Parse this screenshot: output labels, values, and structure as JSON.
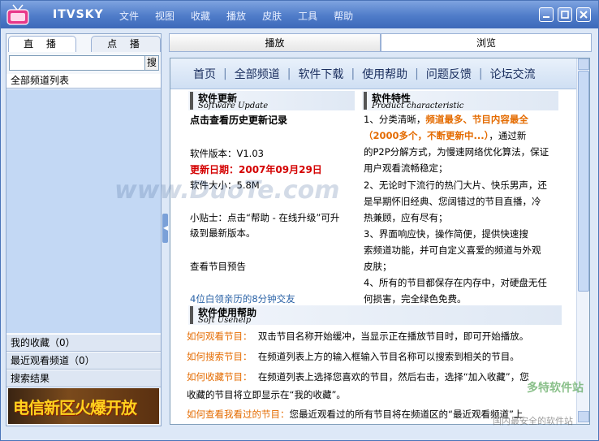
{
  "app": {
    "brand": "ITVSKY"
  },
  "menu": [
    "文件",
    "视图",
    "收藏",
    "播放",
    "皮肤",
    "工具",
    "帮助"
  ],
  "left": {
    "tab_live": "直 播",
    "tab_vod": "点 播",
    "search_value": "",
    "search_button": "搜",
    "channel_header": "全部频道列表",
    "favorites": "我的收藏（0）",
    "recent": "最近观看频道（0）",
    "results": "搜索结果",
    "ad_text": "电信新区火爆开放"
  },
  "right": {
    "tab_play": "播放",
    "tab_browse": "浏览"
  },
  "nav": [
    "首页",
    "全部频道",
    "软件下载",
    "使用帮助",
    "问题反馈",
    "论坛交流"
  ],
  "update": {
    "title": "软件更新",
    "subtitle": "Software Update",
    "history_link": "点击查看历史更新记录",
    "version": "软件版本：V1.03",
    "date": "更新日期：2007年09月29日",
    "size": "软件大小：5.8M",
    "tip_line1": "小贴士：点击“帮助 - 在线升级”可升",
    "tip_line2": "级到最新版本。",
    "preview": "查看节目预告",
    "story": "4位白领亲历的8分钟交友"
  },
  "features": {
    "title": "软件特性",
    "subtitle": "Product characteristic",
    "l1a": "1、分类清晰，",
    "l1b": "频道最多、节目内容最全",
    "l2a": "（2000多个，不断更新中...）",
    "l2b": "，通过新",
    "l3": "的P2P分解方式，为慢速网络优化算法，保证",
    "l4": "用户观看流畅稳定；",
    "l5": "2、无论时下流行的热门大片、快乐男声，还",
    "l6": "是早期怀旧经典、您阔错过的节目直播，冷",
    "l7": "热兼顾，应有尽有；",
    "l8": "3、界面响应快，操作简便，提供快速搜",
    "l9": "索频道功能，并可自定义喜爱的频道与外观",
    "l10": "皮肤；",
    "l11": "4、所有的节目都保存在内存中，对硬盘无任",
    "l12": "何损害，完全绿色免费。"
  },
  "help": {
    "title": "软件使用帮助",
    "subtitle": "Soft Usehelp",
    "q1": "如何观看节目：",
    "a1": "双击节目名称开始缓冲，当显示正在播放节目时，即可开始播放。",
    "q2": "如何搜索节目：",
    "a2": "在频道列表上方的输入框输入节目名称可以搜索到相关的节目。",
    "q3": "如何收藏节目：",
    "a3": "在频道列表上选择您喜欢的节目，然后右击，选择“加入收藏”，您",
    "a3b": "收藏的节目将立即显示在“我的收藏”。",
    "q4": "如何查看我看过的节目：",
    "a4": "您最近观看过的所有节目将在频道区的“最近观看频道”上"
  },
  "watermarks": {
    "w1": "www.DuoTe.com",
    "w2": "多特软件站",
    "w3": "国内最安全的软件站"
  },
  "colors": {
    "accent": "#4f7cc9",
    "highlight": "#e46b00",
    "date": "#d40000"
  }
}
